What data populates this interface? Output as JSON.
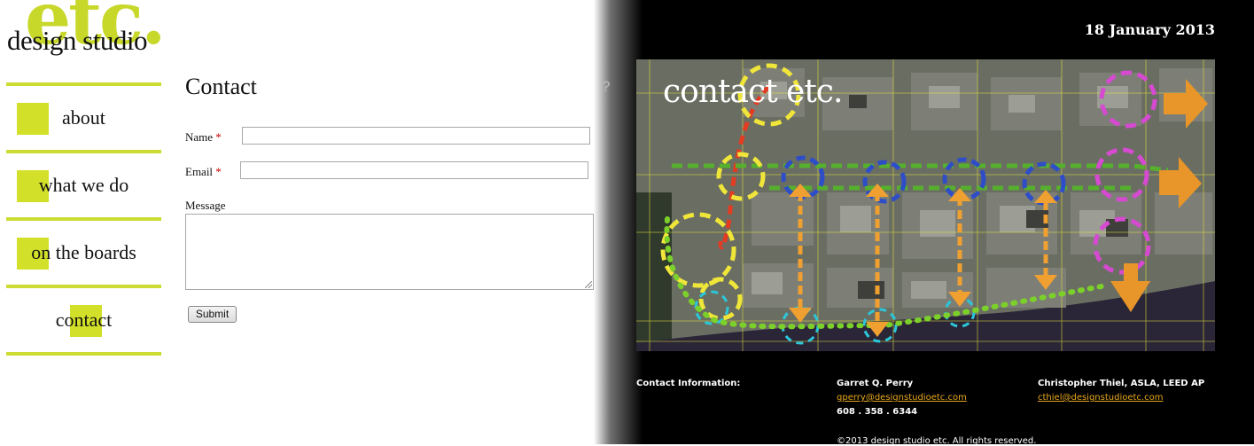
{
  "logo": {
    "etc": "etc.",
    "name": "design studio"
  },
  "nav": {
    "items": [
      {
        "label": "about"
      },
      {
        "label": "what we do"
      },
      {
        "label": "on the boards"
      },
      {
        "label": "contact"
      }
    ]
  },
  "form": {
    "title": "Contact",
    "name_label": "Name",
    "email_label": "Email",
    "required_mark": "*",
    "message_label": "Message",
    "name_value": "",
    "email_value": "",
    "submit_label": "Submit"
  },
  "header": {
    "date": "18 January 2013"
  },
  "hero": {
    "title": "contact etc."
  },
  "contact_info": {
    "heading": "Contact Information:",
    "people": [
      {
        "name": "Garret Q. Perry",
        "email": "gperry@designstudioetc.com",
        "phone": "608 . 358 . 6344"
      },
      {
        "name": "Christopher Thiel, ASLA, LEED AP",
        "email": "cthiel@designstudioetc.com"
      }
    ],
    "copyright": "©2013 design studio etc. All rights reserved."
  },
  "colors": {
    "accent": "#d2e02a",
    "link": "#e8a81e",
    "background_dark": "#000000"
  }
}
